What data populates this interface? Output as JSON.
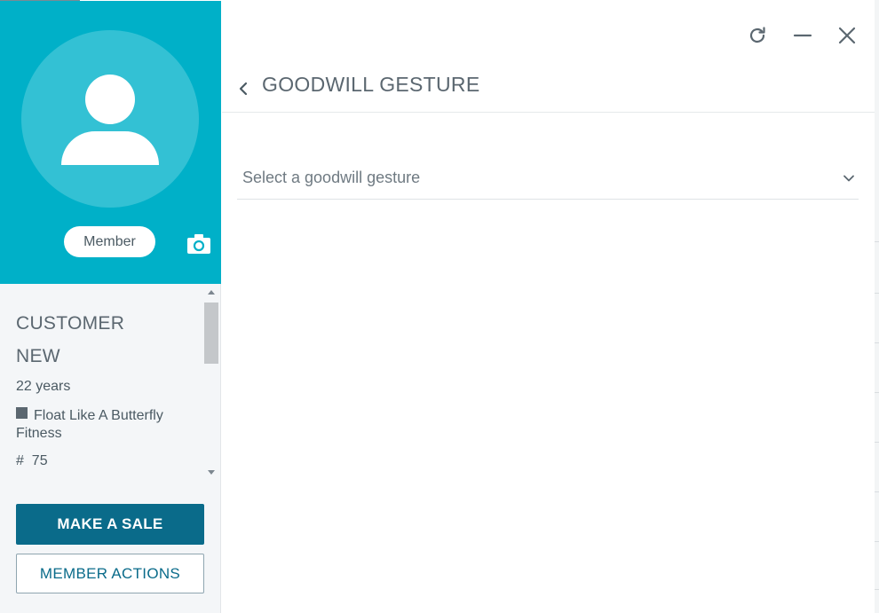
{
  "sidebar": {
    "membership_badge": "Member",
    "customer_label": "CUSTOMER",
    "status_label": "NEW",
    "age": "22 years",
    "club_name": "Float Like A Butterfly Fitness",
    "member_number_prefix": "#",
    "member_number": "75",
    "make_sale_label": "MAKE A SALE",
    "member_actions_label": "MEMBER ACTIONS"
  },
  "panel": {
    "title": "GOODWILL GESTURE",
    "select_placeholder": "Select a goodwill gesture"
  },
  "icons": {
    "refresh": "refresh-icon",
    "minimize": "minimize-icon",
    "close": "close-icon",
    "back": "chevron-left-icon",
    "dropdown": "chevron-down-icon",
    "camera": "camera-icon",
    "avatar": "user-avatar-icon"
  },
  "colors": {
    "hero_background": "#00b0c8",
    "primary_button": "#0a6b8a",
    "text_muted": "#5b6770"
  }
}
